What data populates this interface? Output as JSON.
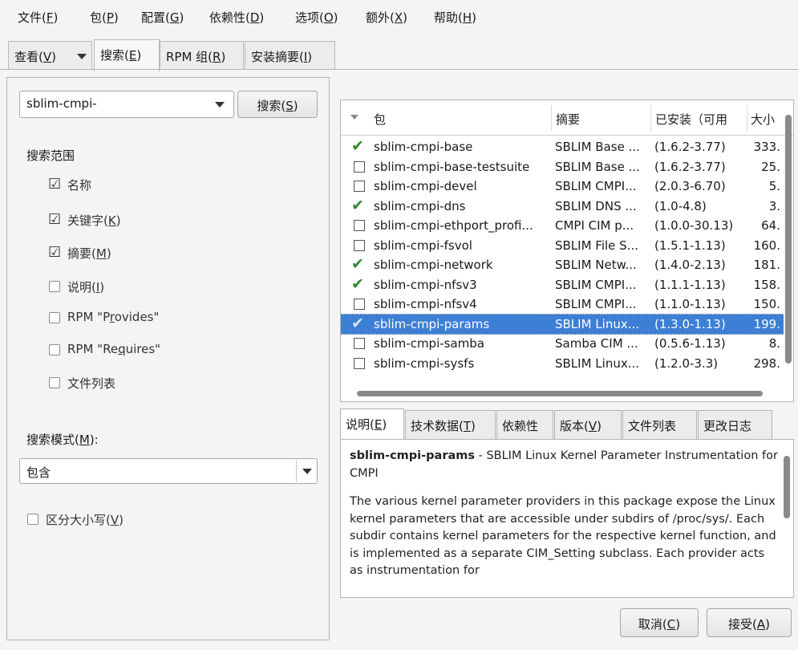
{
  "menubar": [
    {
      "label": "文件(",
      "key": "F",
      "suffix": ")"
    },
    {
      "label": "包(",
      "key": "P",
      "suffix": ")"
    },
    {
      "label": "配置(",
      "key": "G",
      "suffix": ")"
    },
    {
      "label": "依赖性(",
      "key": "D",
      "suffix": ")"
    },
    {
      "label": "选项(",
      "key": "O",
      "suffix": ")"
    },
    {
      "label": "额外(",
      "key": "X",
      "suffix": ")"
    },
    {
      "label": "帮助(",
      "key": "H",
      "suffix": ")"
    }
  ],
  "view_tabs": {
    "view": {
      "label": "查看(",
      "key": "V",
      "suffix": ")"
    },
    "search": {
      "label": "搜索(",
      "key": "E",
      "suffix": ")"
    },
    "rpm_groups": {
      "label": "RPM 组(",
      "key": "R",
      "suffix": ")"
    },
    "install_summary": {
      "label": "安装摘要(",
      "key": "I",
      "suffix": ")"
    }
  },
  "search": {
    "query": "sblim-cmpi-",
    "button": {
      "label": "搜索(",
      "key": "S",
      "suffix": ")"
    },
    "scope_title": "搜索范围",
    "options": [
      {
        "label": "名称",
        "checked": true
      },
      {
        "label": "关键字(",
        "key": "K",
        "suffix": ")",
        "checked": true
      },
      {
        "label": "摘要(",
        "key": "M",
        "suffix": ")",
        "checked": true
      },
      {
        "label": "说明(",
        "key": "I",
        "suffix": ")",
        "checked": false
      },
      {
        "label": "RPM \"P",
        "key": "r",
        "suffix": "ovides\"",
        "checked": false
      },
      {
        "label": "RPM \"Re",
        "key": "q",
        "suffix": "uires\"",
        "checked": false
      },
      {
        "label": "文件列表",
        "checked": false
      }
    ],
    "mode_label": {
      "label": "搜索模式(",
      "key": "M",
      "suffix": "):"
    },
    "mode_value": "包含",
    "case_sensitive": {
      "label": "区分大小写(",
      "key": "V",
      "suffix": ")",
      "checked": false
    }
  },
  "package_list": {
    "columns": [
      "包",
      "摘要",
      "已安装（可用",
      "大小"
    ],
    "rows": [
      {
        "name": "sblim-cmpi-base",
        "summary": "SBLIM Base ...",
        "version": "(1.6.2-3.77)",
        "size": "333.",
        "installed": true,
        "selected": false
      },
      {
        "name": "sblim-cmpi-base-testsuite",
        "summary": "SBLIM Base ...",
        "version": "(1.6.2-3.77)",
        "size": "25.",
        "installed": false,
        "selected": false
      },
      {
        "name": "sblim-cmpi-devel",
        "summary": "SBLIM CMPI...",
        "version": "(2.0.3-6.70)",
        "size": "5.",
        "installed": false,
        "selected": false
      },
      {
        "name": "sblim-cmpi-dns",
        "summary": "SBLIM DNS ...",
        "version": "(1.0-4.8)",
        "size": "3.",
        "installed": true,
        "selected": false
      },
      {
        "name": "sblim-cmpi-ethport_profi...",
        "summary": "CMPI CIM p...",
        "version": "(1.0.0-30.13)",
        "size": "64.",
        "installed": false,
        "selected": false
      },
      {
        "name": "sblim-cmpi-fsvol",
        "summary": "SBLIM File S...",
        "version": "(1.5.1-1.13)",
        "size": "160.",
        "installed": false,
        "selected": false
      },
      {
        "name": "sblim-cmpi-network",
        "summary": "SBLIM Netw...",
        "version": "(1.4.0-2.13)",
        "size": "181.",
        "installed": true,
        "selected": false
      },
      {
        "name": "sblim-cmpi-nfsv3",
        "summary": "SBLIM CMPI...",
        "version": "(1.1.1-1.13)",
        "size": "158.",
        "installed": true,
        "selected": false
      },
      {
        "name": "sblim-cmpi-nfsv4",
        "summary": "SBLIM CMPI...",
        "version": "(1.1.0-1.13)",
        "size": "150.",
        "installed": false,
        "selected": false
      },
      {
        "name": "sblim-cmpi-params",
        "summary": "SBLIM Linux...",
        "version": "(1.3.0-1.13)",
        "size": "199.",
        "installed": true,
        "selected": true
      },
      {
        "name": "sblim-cmpi-samba",
        "summary": "Samba CIM ...",
        "version": "(0.5.6-1.13)",
        "size": "8.",
        "installed": false,
        "selected": false
      },
      {
        "name": "sblim-cmpi-sysfs",
        "summary": "SBLIM Linux...",
        "version": "(1.2.0-3.3)",
        "size": "298.",
        "installed": false,
        "selected": false
      }
    ]
  },
  "detail_tabs": [
    {
      "label": "说明(",
      "key": "E",
      "suffix": ")"
    },
    {
      "label": "技术数据(",
      "key": "T",
      "suffix": ")"
    },
    {
      "label": "依赖性"
    },
    {
      "label": "版本(",
      "key": "V",
      "suffix": ")"
    },
    {
      "label": "文件列表"
    },
    {
      "label": "更改日志"
    }
  ],
  "description": {
    "pkg_name": "sblim-cmpi-params",
    "pkg_summary": " - SBLIM Linux Kernel Parameter Instrumentation for CMPI",
    "body": "The various kernel parameter providers in this package expose the Linux kernel parameters that are accessible under subdirs of /proc/sys/. Each subdir contains kernel parameters for the respective kernel function, and is implemented as a separate CIM_Setting subclass. Each provider acts as instrumentation for"
  },
  "footer": {
    "cancel": {
      "label": "取消(",
      "key": "C",
      "suffix": ")"
    },
    "accept": {
      "label": "接受(",
      "key": "A",
      "suffix": ")"
    }
  },
  "colors": {
    "selection": "#3d7fd4",
    "check_green": "#2f8a2f"
  }
}
